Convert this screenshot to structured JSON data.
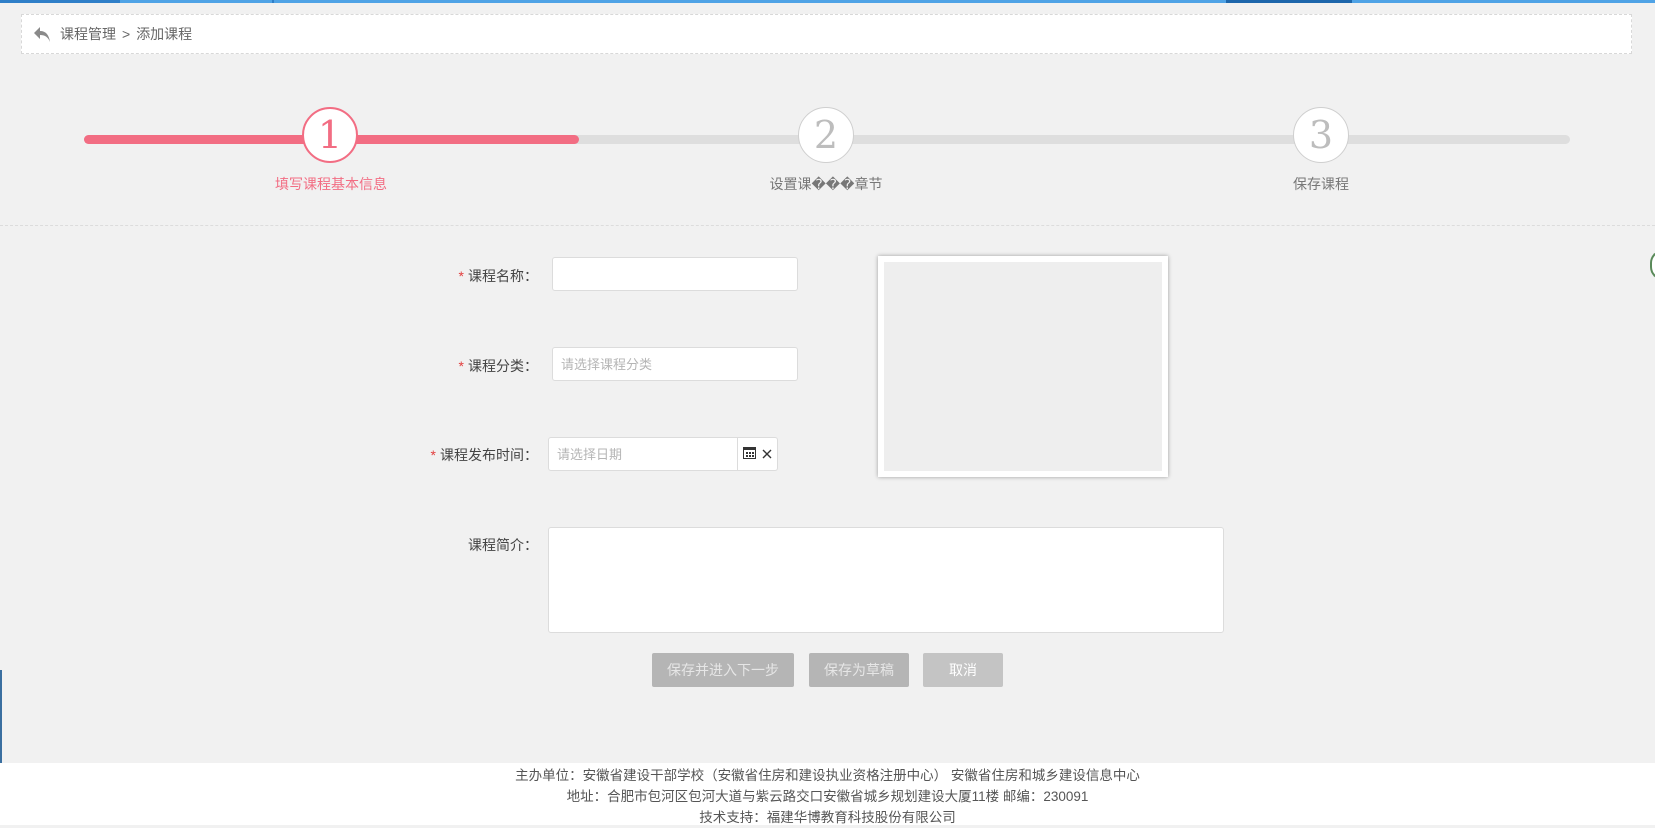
{
  "breadcrumb": {
    "parent": "课程管理",
    "separator": ">",
    "current": "添加课程"
  },
  "steps": [
    {
      "number": "1",
      "label": "填写课程基本信息",
      "active": true
    },
    {
      "number": "2",
      "label": "设置课���章节",
      "active": false
    },
    {
      "number": "3",
      "label": "保存课程",
      "active": false
    }
  ],
  "form": {
    "required_mark": "*",
    "name_label": "课程名称：",
    "name_value": "",
    "category_label": "课程分类：",
    "category_placeholder": "请选择课程分类",
    "publish_label": "课程发布时间：",
    "publish_placeholder": "请选择日期",
    "intro_label": "课程简介：",
    "intro_value": ""
  },
  "buttons": {
    "save_next": "保存并进入下一步",
    "save_draft": "保存为草稿",
    "cancel": "取消"
  },
  "footer": {
    "line1": "主办单位：安徽省建设干部学校（安徽省住房和建设执业资格注册中心） 安徽省住房和城乡建设信息中心",
    "line2": "地址：合肥市包河区包河大道与紫云路交口安徽省城乡规划建设大厦11楼 邮编：230091",
    "line3": "技术支持：福建华博教育科技股份有限公司"
  },
  "colors": {
    "accent": "#f26d83",
    "track": "#dedede",
    "required": "#e23d3d",
    "button_disabled": "#b5b5b5"
  }
}
